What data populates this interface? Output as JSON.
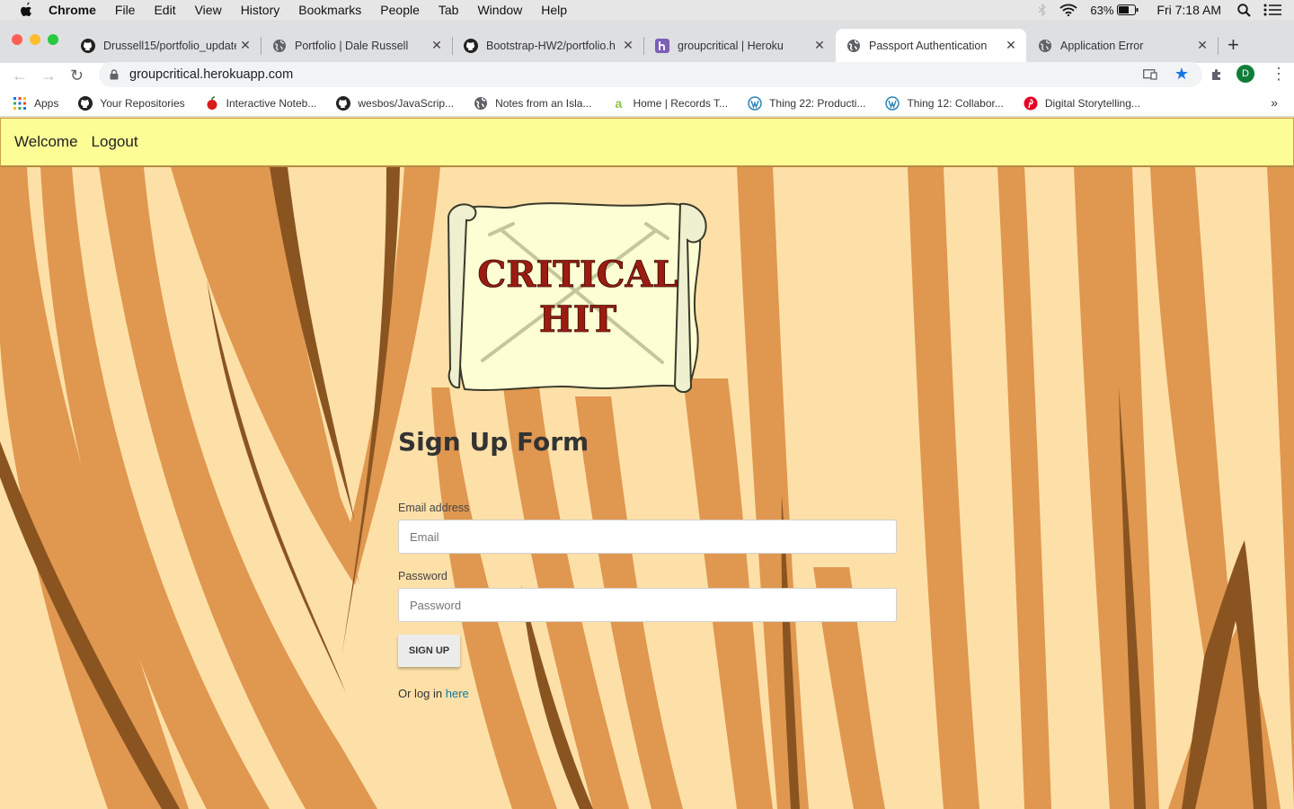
{
  "menubar": {
    "app": "Chrome",
    "items": [
      "File",
      "Edit",
      "View",
      "History",
      "Bookmarks",
      "People",
      "Tab",
      "Window",
      "Help"
    ],
    "battery": "63%",
    "clock": "Fri 7:18 AM"
  },
  "tabs": [
    {
      "title": "Drussell15/portfolio_update",
      "icon": "github-icon",
      "active": false
    },
    {
      "title": "Portfolio | Dale Russell",
      "icon": "globe-icon",
      "active": false
    },
    {
      "title": "Bootstrap-HW2/portfolio.h",
      "icon": "github-icon",
      "active": false
    },
    {
      "title": "groupcritical | Heroku",
      "icon": "heroku-icon",
      "active": false
    },
    {
      "title": "Passport Authentication",
      "icon": "globe-icon",
      "active": true
    },
    {
      "title": "Application Error",
      "icon": "globe-icon",
      "active": false
    }
  ],
  "address_bar": {
    "url": "groupcritical.herokuapp.com"
  },
  "profile_initial": "D",
  "bookmarks": [
    {
      "label": "Apps",
      "icon": "apps-grid-icon"
    },
    {
      "label": "Your Repositories",
      "icon": "github-icon"
    },
    {
      "label": "Interactive Noteb...",
      "icon": "apple-icon"
    },
    {
      "label": "wesbos/JavaScrip...",
      "icon": "github-icon"
    },
    {
      "label": "Notes from an Isla...",
      "icon": "globe-icon"
    },
    {
      "label": "Home | Records T...",
      "icon": "a-icon"
    },
    {
      "label": "Thing 22: Producti...",
      "icon": "wordpress-icon"
    },
    {
      "label": "Thing 12: Collabor...",
      "icon": "wordpress-icon"
    },
    {
      "label": "Digital Storytelling...",
      "icon": "pinterest-icon"
    }
  ],
  "app_nav": {
    "welcome": "Welcome",
    "logout": "Logout"
  },
  "logo_text": {
    "line1": "CRITICAL",
    "line2": "HIT"
  },
  "form": {
    "title": "Sign Up Form",
    "email_label": "Email address",
    "email_placeholder": "Email",
    "password_label": "Password",
    "password_placeholder": "Password",
    "submit_label": "SIGN UP",
    "login_prefix": "Or log in",
    "login_link": "here"
  },
  "colors": {
    "nav_bg": "#fdfd96",
    "wood_light": "#fde0a8",
    "wood_mid": "#e0974f",
    "wood_dark": "#8a5421",
    "link": "#0a7aa8"
  }
}
